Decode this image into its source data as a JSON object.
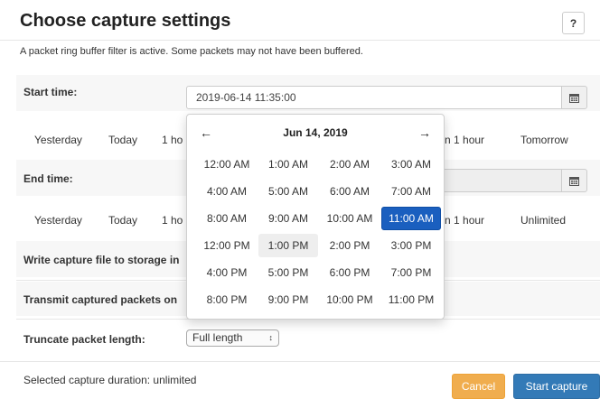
{
  "header": {
    "title": "Choose capture settings",
    "help_label": "?"
  },
  "notice": "A packet ring buffer filter is active. Some packets may not have been buffered.",
  "start": {
    "label": "Start time:",
    "value": "2019-06-14 11:35:00",
    "quick_left": [
      "Yesterday",
      "Today",
      "1 ho"
    ],
    "quick_right": [
      "n 1 hour",
      "Tomorrow"
    ]
  },
  "end": {
    "label": "End time:",
    "value": "",
    "quick_left": [
      "Yesterday",
      "Today",
      "1 ho"
    ],
    "quick_right": [
      "n 1 hour",
      "Unlimited"
    ]
  },
  "rows": {
    "write_label": "Write capture file to storage in",
    "transmit_label": "Transmit captured packets on",
    "truncate_label": "Truncate packet length:"
  },
  "truncate_select": {
    "selected": "Full length",
    "arrows": "↕"
  },
  "calendar_icon": "calendar-icon",
  "popup": {
    "month": "Jun 14, 2019",
    "prev": "←",
    "next": "→",
    "hours": [
      "12:00 AM",
      "1:00 AM",
      "2:00 AM",
      "3:00 AM",
      "4:00 AM",
      "5:00 AM",
      "6:00 AM",
      "7:00 AM",
      "8:00 AM",
      "9:00 AM",
      "10:00 AM",
      "11:00 AM",
      "12:00 PM",
      "1:00 PM",
      "2:00 PM",
      "3:00 PM",
      "4:00 PM",
      "5:00 PM",
      "6:00 PM",
      "7:00 PM",
      "8:00 PM",
      "9:00 PM",
      "10:00 PM",
      "11:00 PM"
    ],
    "selected": "11:00 AM",
    "hovered": "1:00 PM"
  },
  "footer": {
    "status": "Selected capture duration: unlimited",
    "cancel": "Cancel",
    "start": "Start capture"
  },
  "colors": {
    "primary": "#337ab7",
    "warning": "#f0ad4e",
    "selected": "#1a5fbf"
  }
}
